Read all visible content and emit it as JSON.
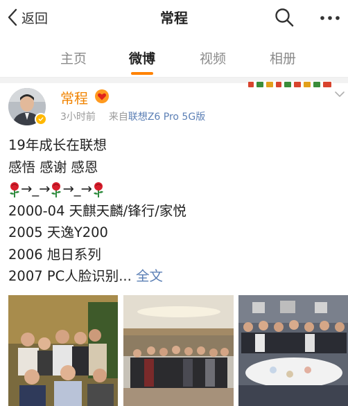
{
  "header": {
    "back_label": "返回",
    "title": "常程"
  },
  "tabs": [
    {
      "label": "主页",
      "active": false
    },
    {
      "label": "微博",
      "active": true
    },
    {
      "label": "视频",
      "active": false
    },
    {
      "label": "相册",
      "active": false
    }
  ],
  "post": {
    "author": "常程",
    "time": "3小时前",
    "source_prefix": "来自",
    "source": "联想Z6 Pro 5G版",
    "lines": {
      "l1": "19年成长在联想",
      "l2": "感悟 感谢 感恩",
      "l3_arrow": "→_→",
      "l4": "2000-04 天麒天麟/锋行/家悦",
      "l5": "2005 天逸Y200",
      "l6": "2006 旭日系列",
      "l7": "2007 PC人脸识别... "
    },
    "more_label": "全文",
    "photo_count": 3
  },
  "colors": {
    "accent": "#ff8200",
    "username": "#f08300",
    "link": "#5b7fb5",
    "muted": "#999999"
  },
  "icons": [
    "chevron-left-icon",
    "search-icon",
    "more-icon",
    "verified-icon",
    "vip-heart-icon",
    "chevron-down-icon",
    "rose-icon"
  ]
}
